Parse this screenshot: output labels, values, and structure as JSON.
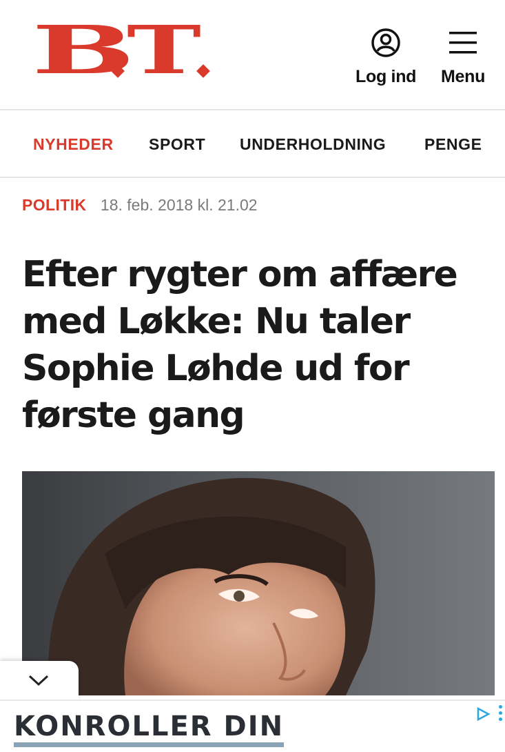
{
  "header": {
    "logo_text": "B.T.",
    "login_label": "Log ind",
    "menu_label": "Menu"
  },
  "nav": {
    "items": [
      {
        "label": "NYHEDER",
        "active": true
      },
      {
        "label": "SPORT",
        "active": false
      },
      {
        "label": "UNDERHOLDNING",
        "active": false
      },
      {
        "label": "PENGE",
        "active": false
      }
    ]
  },
  "article": {
    "category": "POLITIK",
    "date": "18. feb. 2018 kl. 21.02",
    "headline": "Efter rygter om affære med Løkke: Nu taler Sophie Løhde ud for første gang"
  },
  "ad": {
    "text": "KONROLLER DIN"
  },
  "colors": {
    "brand_red": "#d93a2b",
    "text_dark": "#1a1a1a",
    "date_gray": "#7a7a7a",
    "ad_underline": "#8aa4b6"
  },
  "icons": {
    "login": "user-circle-icon",
    "menu": "hamburger-icon",
    "collapse": "chevron-down-icon",
    "ad_choices": "ad-choices-icon"
  }
}
